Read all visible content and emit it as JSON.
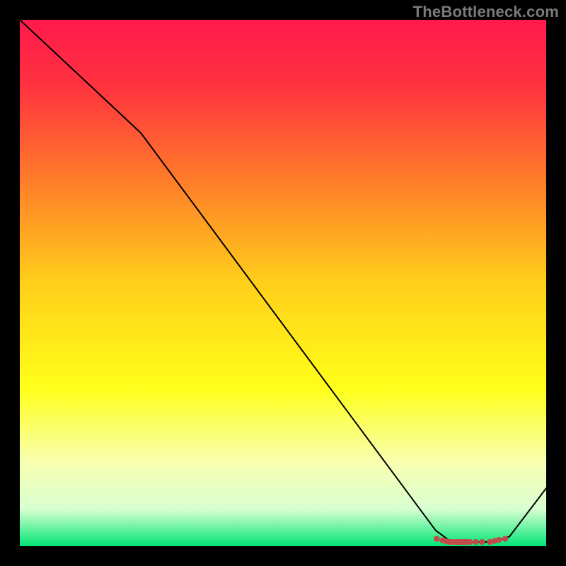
{
  "attribution": "TheBottleneck.com",
  "chart_data": {
    "type": "line",
    "title": "",
    "xlabel": "",
    "ylabel": "",
    "xlim": [
      0,
      100
    ],
    "ylim": [
      0,
      100
    ],
    "grid": false,
    "legend": false,
    "background_gradient_stops": [
      {
        "offset": 0.0,
        "color": "#ff1a4d"
      },
      {
        "offset": 0.12,
        "color": "#ff3040"
      },
      {
        "offset": 0.3,
        "color": "#ff7a2a"
      },
      {
        "offset": 0.5,
        "color": "#ffcf1a"
      },
      {
        "offset": 0.7,
        "color": "#ffff1a"
      },
      {
        "offset": 0.84,
        "color": "#f8ffb0"
      },
      {
        "offset": 0.93,
        "color": "#d8ffd0"
      },
      {
        "offset": 1.0,
        "color": "#00e676"
      }
    ],
    "series": [
      {
        "name": "bottleneck-curve",
        "stroke": "#000000",
        "stroke_width": 2,
        "x": [
          0.0,
          23.0,
          79.0,
          82.0,
          90.0,
          93.0,
          100.0
        ],
        "values": [
          100.0,
          78.5,
          3.0,
          0.8,
          0.8,
          1.8,
          11.0
        ]
      }
    ],
    "markers": {
      "name": "highlight-points",
      "color": "#c24a4a",
      "radius": 4.2,
      "points": [
        {
          "x": 79.2,
          "y": 1.4
        },
        {
          "x": 80.3,
          "y": 1.1
        },
        {
          "x": 81.1,
          "y": 0.9
        },
        {
          "x": 81.7,
          "y": 0.8
        },
        {
          "x": 82.3,
          "y": 0.8
        },
        {
          "x": 82.9,
          "y": 0.8
        },
        {
          "x": 83.4,
          "y": 0.8
        },
        {
          "x": 83.9,
          "y": 0.8
        },
        {
          "x": 84.4,
          "y": 0.8
        },
        {
          "x": 84.9,
          "y": 0.8
        },
        {
          "x": 85.5,
          "y": 0.8
        },
        {
          "x": 86.6,
          "y": 0.8
        },
        {
          "x": 87.8,
          "y": 0.8
        },
        {
          "x": 89.3,
          "y": 0.8
        },
        {
          "x": 90.2,
          "y": 1.0
        },
        {
          "x": 91.0,
          "y": 1.2
        },
        {
          "x": 92.2,
          "y": 1.4
        }
      ]
    }
  }
}
